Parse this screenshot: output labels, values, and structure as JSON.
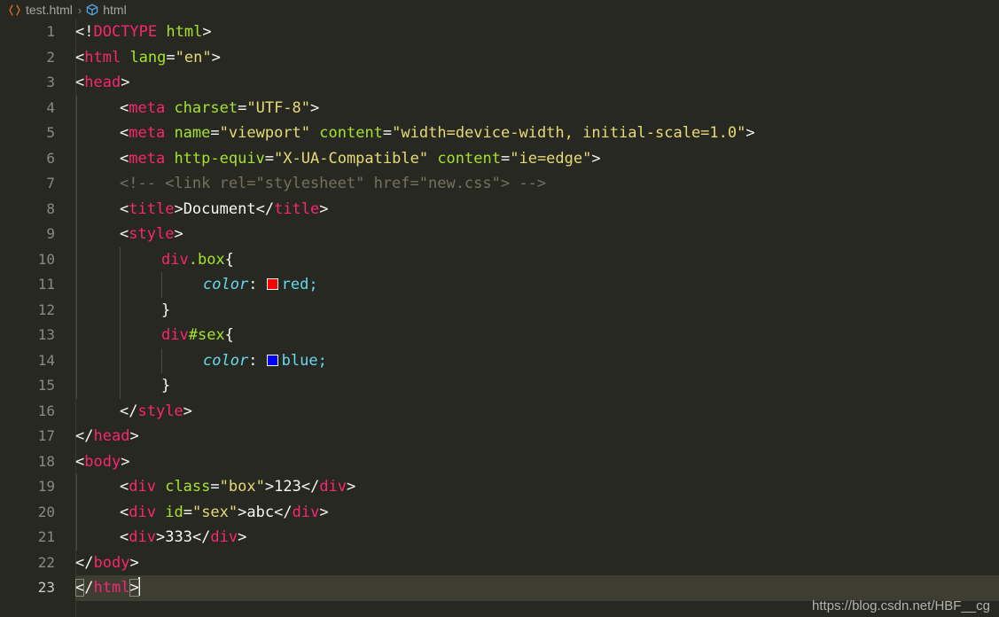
{
  "breadcrumb": {
    "file_icon": "code-brackets-icon",
    "file_label": "test.html",
    "separator": "›",
    "symbol_icon": "cube-symbol-icon",
    "symbol_label": "html"
  },
  "editor": {
    "active_line": 23,
    "cursor_column_text": "</html>",
    "total_lines": 23,
    "theme": {
      "background": "#272822",
      "active_line_background": "#3e3d32",
      "line_number": "#8a8a80",
      "tag": "#f92672",
      "attribute": "#a6e22e",
      "string": "#e6db74",
      "comment": "#75715e",
      "property": "#66d9ef",
      "text": "#f8f8f2",
      "indent_guide": "#4a4a42"
    },
    "lines": [
      {
        "n": "1",
        "text": "<!DOCTYPE html>"
      },
      {
        "n": "2",
        "text": "<html lang=\"en\">"
      },
      {
        "n": "3",
        "text": "<head>"
      },
      {
        "n": "4",
        "text": "    <meta charset=\"UTF-8\">"
      },
      {
        "n": "5",
        "text": "    <meta name=\"viewport\" content=\"width=device-width, initial-scale=1.0\">"
      },
      {
        "n": "6",
        "text": "    <meta http-equiv=\"X-UA-Compatible\" content=\"ie=edge\">"
      },
      {
        "n": "7",
        "text": "    <!-- <link rel=\"stylesheet\" href=\"new.css\"> -->"
      },
      {
        "n": "8",
        "text": "    <title>Document</title>"
      },
      {
        "n": "9",
        "text": "    <style>"
      },
      {
        "n": "10",
        "text": "        div.box{"
      },
      {
        "n": "11",
        "text": "            color: red;"
      },
      {
        "n": "12",
        "text": "        }"
      },
      {
        "n": "13",
        "text": "        div#sex{"
      },
      {
        "n": "14",
        "text": "            color: blue;"
      },
      {
        "n": "15",
        "text": "        }"
      },
      {
        "n": "16",
        "text": "    </style>"
      },
      {
        "n": "17",
        "text": "</head>"
      },
      {
        "n": "18",
        "text": "<body>"
      },
      {
        "n": "19",
        "text": "    <div class=\"box\">123</div>"
      },
      {
        "n": "20",
        "text": "    <div id=\"sex\">abc</div>"
      },
      {
        "n": "21",
        "text": "    <div>333</div>"
      },
      {
        "n": "22",
        "text": "</body>"
      },
      {
        "n": "23",
        "text": "</html>"
      }
    ],
    "tokens": {
      "doctype_open": "<!",
      "doctype_word": "DOCTYPE",
      "doctype_name": " html",
      "gt": ">",
      "lt": "<",
      "close_lt": "</",
      "eq": "=",
      "quote": "\"",
      "tag_html": "html",
      "tag_head": "head",
      "tag_meta": "meta",
      "tag_title": "title",
      "tag_style": "style",
      "tag_body": "body",
      "tag_div": "div",
      "attr_lang": " lang",
      "val_en": "en",
      "attr_charset": " charset",
      "val_utf8": "UTF-8",
      "attr_name": " name",
      "val_viewport": "viewport",
      "attr_content": " content",
      "val_viewport_content": "width=device-width, initial-scale=1.0",
      "attr_httpequiv": " http-equiv",
      "val_xua": "X-UA-Compatible",
      "val_ieedge": "ie=edge",
      "comment_link": "<!-- <link rel=\"stylesheet\" href=\"new.css\"> -->",
      "text_document": "Document",
      "sel_div": "div",
      "sel_box": ".box",
      "sel_sex": "#sex",
      "brace_open": "{",
      "brace_close": "}",
      "prop_color": "color",
      "colon_space": ": ",
      "val_red": "red",
      "val_blue": "blue",
      "semi": ";",
      "attr_class": " class",
      "val_box": "box",
      "attr_id": " id",
      "val_sex": "sex",
      "text_123": "123",
      "text_abc": "abc",
      "text_333": "333",
      "swatch_red": "#ff0000",
      "swatch_blue": "#0000ff"
    }
  },
  "watermark": {
    "text": "https://blog.csdn.net/HBF__cg"
  }
}
